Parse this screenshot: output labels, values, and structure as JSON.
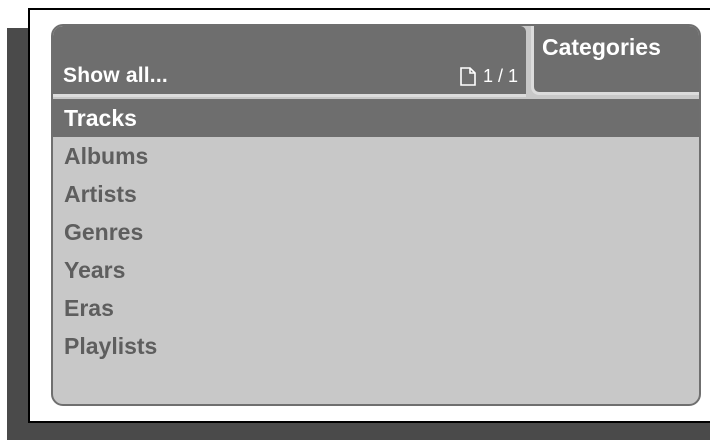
{
  "header": {
    "show_all_label": "Show all...",
    "page_indicator": "1 / 1",
    "page_icon": "document-icon",
    "categories_label": "Categories"
  },
  "categories": {
    "selected_index": 0,
    "items": [
      {
        "label": "Tracks"
      },
      {
        "label": "Albums"
      },
      {
        "label": "Artists"
      },
      {
        "label": "Genres"
      },
      {
        "label": "Years"
      },
      {
        "label": "Eras"
      },
      {
        "label": "Playlists"
      }
    ]
  },
  "colors": {
    "header_bg": "#6e6e6e",
    "panel_bg": "#c8c8c8",
    "item_text": "#5e5e5e",
    "selected_text": "#ffffff"
  }
}
